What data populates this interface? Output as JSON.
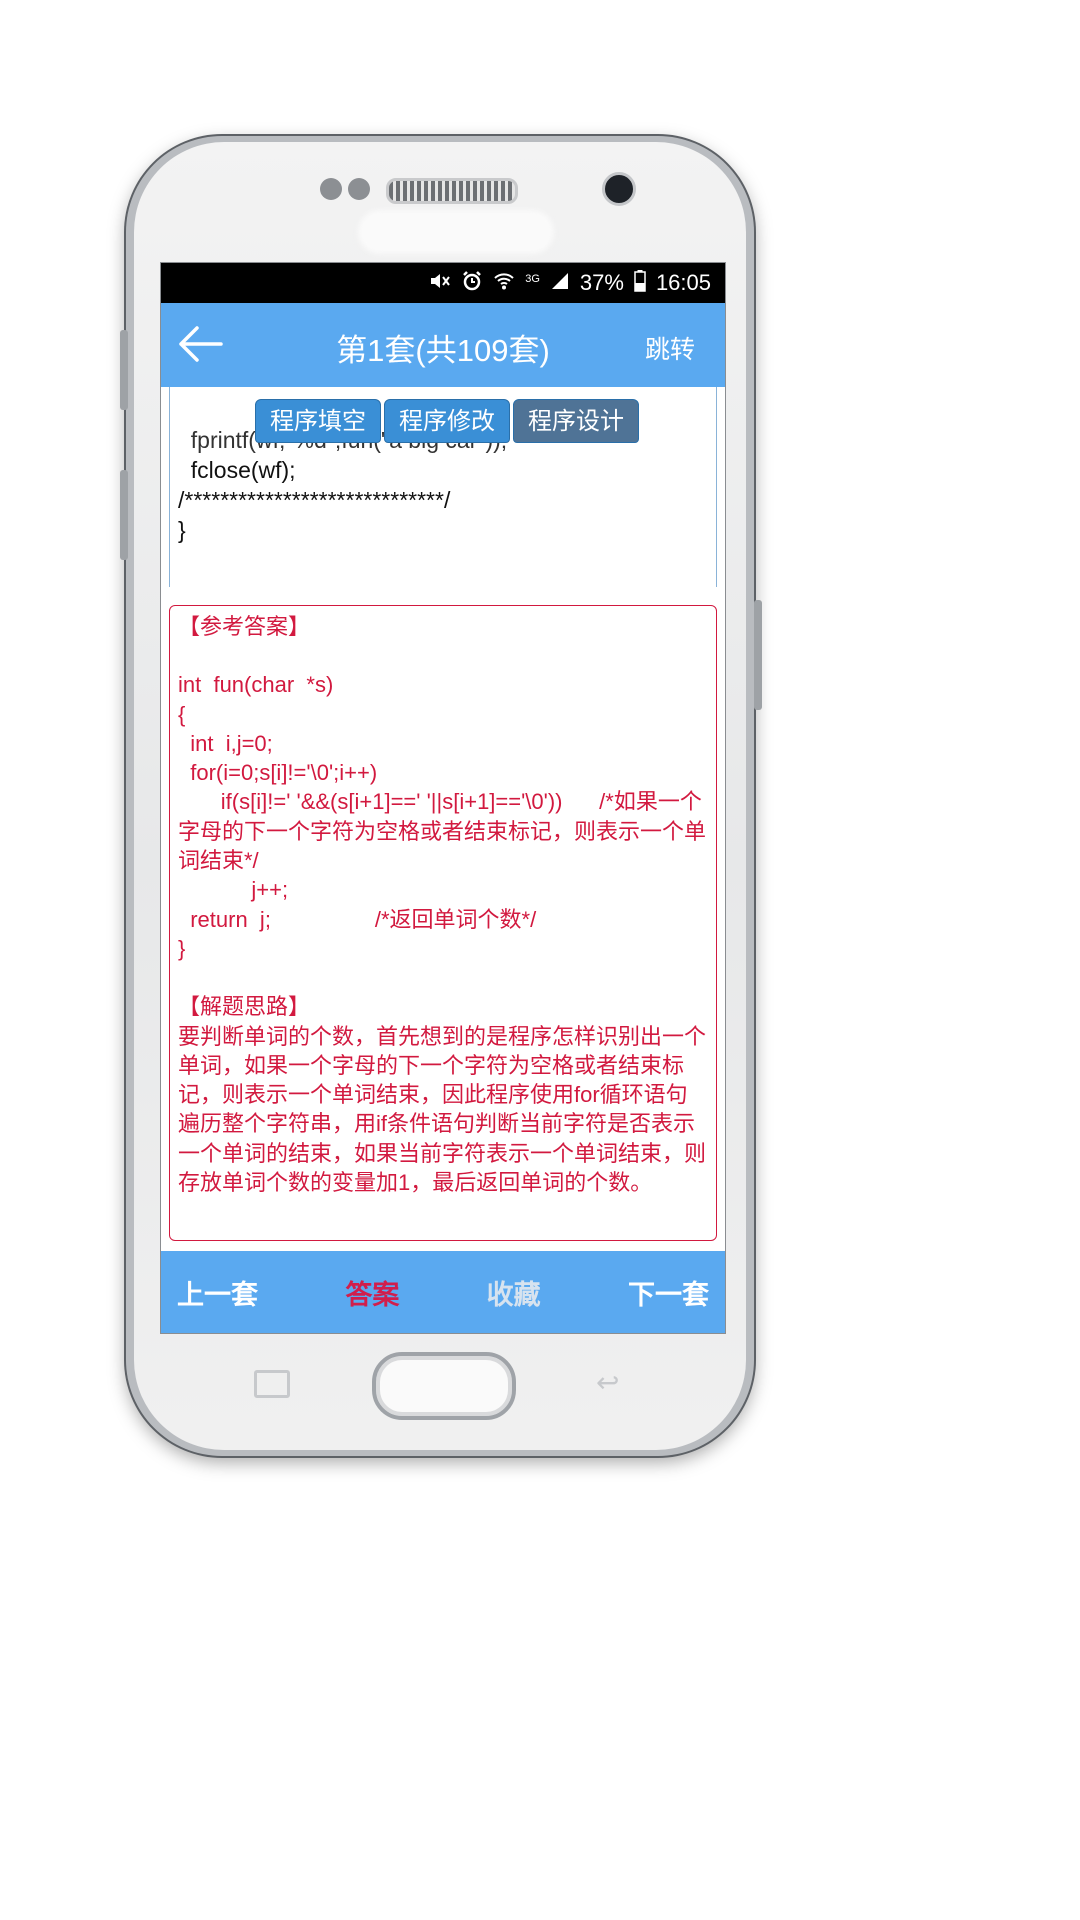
{
  "status_bar": {
    "icons": [
      "mute-icon",
      "alarm-icon",
      "wifi-icon",
      "3g-icon",
      "signal-icon",
      "battery-icon"
    ],
    "network": "3G",
    "battery": "37%",
    "time": "16:05"
  },
  "app_bar": {
    "title": "第1套(共109套)",
    "jump_label": "跳转",
    "back_icon": "arrow-left-icon"
  },
  "tabs": [
    {
      "label": "程序填空"
    },
    {
      "label": "程序修改"
    },
    {
      "label": "程序设计"
    }
  ],
  "code": {
    "lines": [
      "  fprintf(wf,\"%d\",fun(\"a big car\"));",
      "  fclose(wf);",
      "/*****************************/",
      "}"
    ]
  },
  "answer": {
    "heading": "【参考答案】",
    "code": "int  fun(char  *s)\n{\n  int  i,j=0;\n  for(i=0;s[i]!='\\0';i++)\n       if(s[i]!=' '&&(s[i+1]==' '||s[i+1]=='\\0'))      /*如果一个字母的下一个字符为空格或者结束标记，则表示一个单词结束*/\n            j++;\n  return  j;                 /*返回单词个数*/\n}",
    "analysis_heading": "【解题思路】",
    "analysis_text": "要判断单词的个数，首先想到的是程序怎样识别出一个单词，如果一个字母的下一个字符为空格或者结束标记，则表示一个单词结束，因此程序使用for循环语句遍历整个字符串，用if条件语句判断当前字符是否表示一个单词的结束，如果当前字符表示一个单词结束，则存放单词个数的变量加1，最后返回单词的个数。"
  },
  "bottom_bar": {
    "prev_label": "上一套",
    "answer_label": "答案",
    "favorite_label": "收藏",
    "next_label": "下一套"
  },
  "colors": {
    "app_bar": "#5aa9f0",
    "answer_red": "#d2193f",
    "tab_blue": "#3a8fd6",
    "tab_active": "#4f7396"
  }
}
